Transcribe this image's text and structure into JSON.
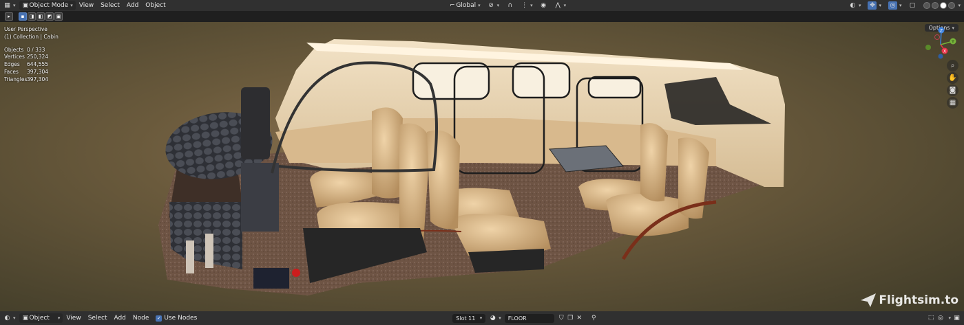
{
  "header": {
    "mode": "Object Mode",
    "menus": [
      "View",
      "Select",
      "Add",
      "Object"
    ],
    "orientation": "Global"
  },
  "viewport": {
    "perspective": "User Perspective",
    "collection": "(1) Collection | Cabin",
    "stats": [
      {
        "label": "Objects",
        "value": "0 / 333"
      },
      {
        "label": "Vertices",
        "value": "250,324"
      },
      {
        "label": "Edges",
        "value": "644,555"
      },
      {
        "label": "Faces",
        "value": "397,304"
      },
      {
        "label": "Triangles",
        "value": "397,304"
      }
    ],
    "options_label": "Options",
    "gizmo_axes": {
      "z": "Z",
      "y": "Y",
      "x": "X"
    },
    "watermark": "Flightsim.to"
  },
  "node_header": {
    "type": "Object",
    "menus": [
      "View",
      "Select",
      "Add",
      "Node"
    ],
    "use_nodes_label": "Use Nodes",
    "slot": "Slot 11",
    "material": "FLOOR"
  },
  "colors": {
    "accent": "#4772b3",
    "axis_x": "#e8334a",
    "axis_y": "#76b33a",
    "axis_z": "#3c82e0"
  }
}
